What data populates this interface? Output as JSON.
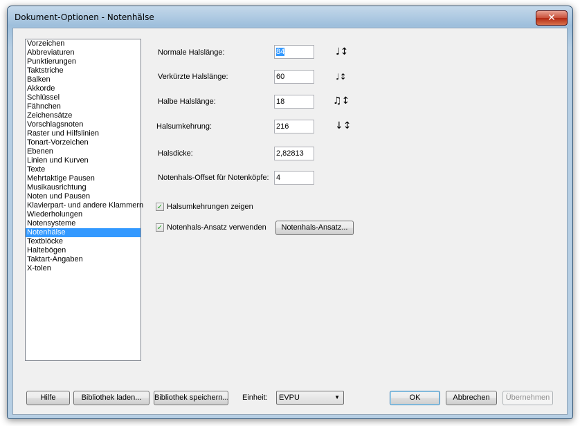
{
  "window": {
    "title": "Dokument-Optionen - Notenhälse",
    "close_glyph": "✕"
  },
  "nav": {
    "items": [
      {
        "label": "Vorzeichen"
      },
      {
        "label": "Abbreviaturen"
      },
      {
        "label": "Punktierungen"
      },
      {
        "label": "Taktstriche"
      },
      {
        "label": "Balken"
      },
      {
        "label": "Akkorde"
      },
      {
        "label": "Schlüssel"
      },
      {
        "label": "Fähnchen"
      },
      {
        "label": "Zeichensätze"
      },
      {
        "label": "Vorschlagsnoten"
      },
      {
        "label": "Raster und Hilfslinien"
      },
      {
        "label": "Tonart-Vorzeichen"
      },
      {
        "label": "Ebenen"
      },
      {
        "label": "Linien und Kurven"
      },
      {
        "label": "Texte"
      },
      {
        "label": "Mehrtaktige Pausen"
      },
      {
        "label": "Musikausrichtung"
      },
      {
        "label": "Noten und Pausen"
      },
      {
        "label": "Klavierpart- und andere Klammern"
      },
      {
        "label": "Wiederholungen"
      },
      {
        "label": "Notensysteme"
      },
      {
        "label": "Notenhälse"
      },
      {
        "label": "Textblöcke"
      },
      {
        "label": "Haltebögen"
      },
      {
        "label": "Taktart-Angaben"
      },
      {
        "label": "X-tolen"
      }
    ],
    "selected": "Notenhälse"
  },
  "fields": {
    "normal_length": {
      "label": "Normale Halslänge:",
      "value": "84",
      "icon": "note-stem-normal-icon"
    },
    "short_length": {
      "label": "Verkürzte Halslänge:",
      "value": "60",
      "icon": "note-stem-short-icon"
    },
    "half_length": {
      "label": "Halbe Halslänge:",
      "value": "18",
      "icon": "beamed-note-stem-icon"
    },
    "reversal": {
      "label": "Halsumkehrung:",
      "value": "216",
      "icon": "note-stem-reversed-icon"
    },
    "thickness": {
      "label": "Halsdicke:",
      "value": "2,82813"
    },
    "offset": {
      "label": "Notenhals-Offset für Notenköpfe:",
      "value": "4"
    }
  },
  "checkboxes": {
    "show_reversals": {
      "label": "Halsumkehrungen zeigen",
      "checked": true
    },
    "use_connection": {
      "label": "Notenhals-Ansatz verwenden",
      "checked": true
    }
  },
  "buttons": {
    "connection": "Notenhals-Ansatz...",
    "help": "Hilfe",
    "load_library": "Bibliothek laden...",
    "save_library": "Bibliothek speichern...",
    "ok": "OK",
    "cancel": "Abbrechen",
    "apply": "Übernehmen"
  },
  "unit": {
    "label": "Einheit:",
    "value": "EVPU"
  },
  "glyphs": {
    "note_normal": "♩↕",
    "note_short": "♩↕",
    "note_beamed": "♫↕",
    "note_reversed": "↓↕",
    "check": "✓",
    "dropdown": "▼"
  }
}
